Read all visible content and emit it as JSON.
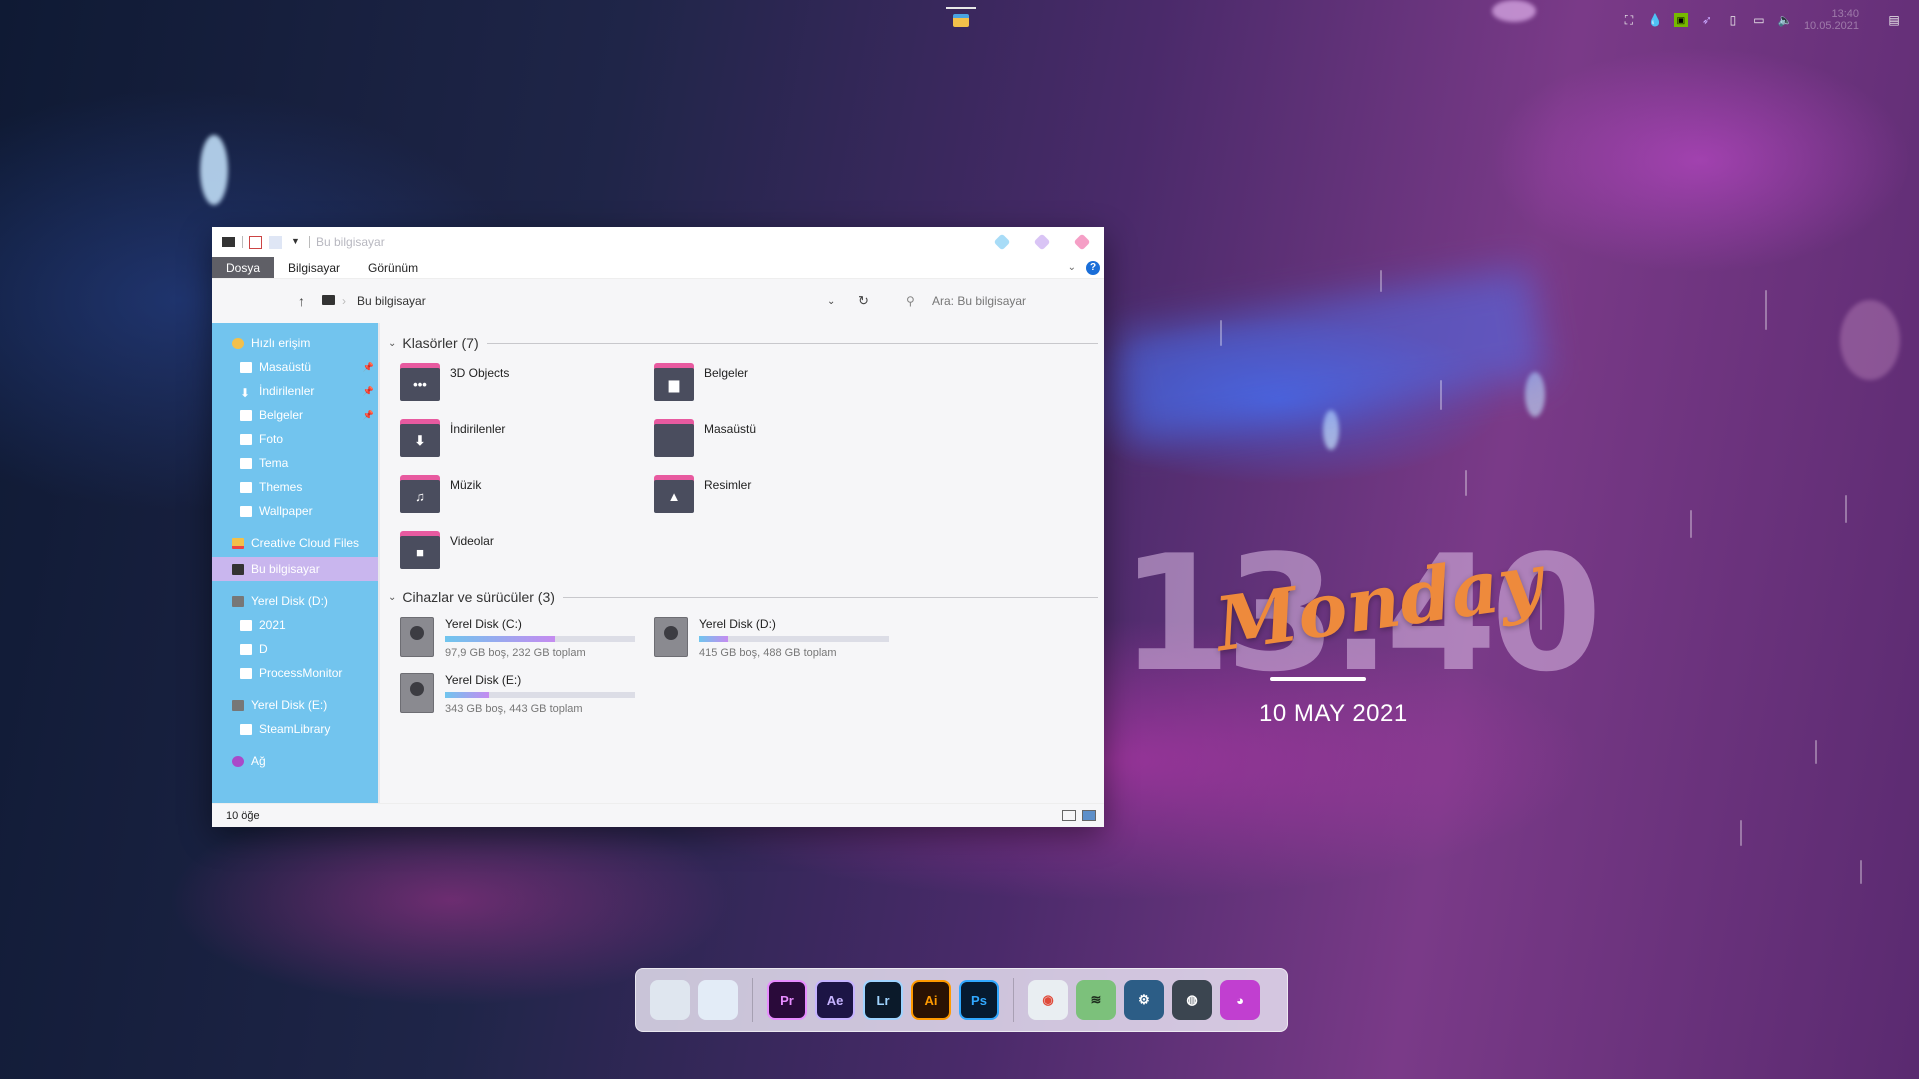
{
  "window": {
    "title": "Bu bilgisayar",
    "ribbon_tabs": [
      "Dosya",
      "Bilgisayar",
      "Görünüm"
    ],
    "help_label": "?",
    "address": {
      "path": "Bu bilgisayar",
      "search_placeholder": "Ara: Bu bilgisayar"
    },
    "nav": {
      "quick_access": "Hızlı erişim",
      "quick_items": [
        {
          "label": "Masaüstü",
          "pinned": true
        },
        {
          "label": "İndirilenler",
          "pinned": true
        },
        {
          "label": "Belgeler",
          "pinned": true
        },
        {
          "label": "Foto",
          "pinned": false
        },
        {
          "label": "Tema",
          "pinned": false
        },
        {
          "label": "Themes",
          "pinned": false
        },
        {
          "label": "Wallpaper",
          "pinned": false
        }
      ],
      "creative_cloud": "Creative Cloud Files",
      "this_pc": "Bu bilgisayar",
      "disk_d": "Yerel Disk (D:)",
      "disk_d_items": [
        "2021",
        "D",
        "ProcessMonitor"
      ],
      "disk_e": "Yerel Disk (E:)",
      "disk_e_items": [
        "SteamLibrary"
      ],
      "network": "Ağ"
    },
    "folders_header": "Klasörler (7)",
    "folders": [
      {
        "name": "3D Objects",
        "icon": "dots-icon",
        "glyph": "•••"
      },
      {
        "name": "Belgeler",
        "icon": "document-icon",
        "glyph": "▆"
      },
      {
        "name": "İndirilenler",
        "icon": "download-icon",
        "glyph": "⬇"
      },
      {
        "name": "Masaüstü",
        "icon": "desktop-icon",
        "glyph": ""
      },
      {
        "name": "Müzik",
        "icon": "music-icon",
        "glyph": "♫"
      },
      {
        "name": "Resimler",
        "icon": "picture-icon",
        "glyph": "▲"
      },
      {
        "name": "Videolar",
        "icon": "video-icon",
        "glyph": "■"
      }
    ],
    "devices_header": "Cihazlar ve sürücüler (3)",
    "drives": [
      {
        "name": "Yerel Disk (C:)",
        "info": "97,9 GB boş, 232 GB toplam",
        "used_fraction": 0.58
      },
      {
        "name": "Yerel Disk (D:)",
        "info": "415 GB boş, 488 GB toplam",
        "used_fraction": 0.15
      },
      {
        "name": "Yerel Disk (E:)",
        "info": "343 GB boş, 443 GB toplam",
        "used_fraction": 0.23
      }
    ],
    "status": "10 öğe"
  },
  "desktop_widget": {
    "time": "13.40",
    "day": "Monday",
    "date": "10 MAY 2021"
  },
  "tray": {
    "time": "13:40",
    "date": "10.05.2021"
  },
  "dock": {
    "items": [
      {
        "icon": "computer-icon",
        "label": "",
        "bg": "#dfe6ef",
        "fg": "#4a6a90"
      },
      {
        "icon": "document-icon",
        "label": "",
        "bg": "#e3ecf7",
        "fg": "#3f7ad6"
      },
      {
        "sep": true
      },
      {
        "icon": "premiere-icon",
        "label": "Pr",
        "bg": "#2a0a3a",
        "fg": "#e88cff"
      },
      {
        "icon": "after-effects-icon",
        "label": "Ae",
        "bg": "#1c1545",
        "fg": "#c6b4ff"
      },
      {
        "icon": "lightroom-icon",
        "label": "Lr",
        "bg": "#0b1a2a",
        "fg": "#9fd4ff"
      },
      {
        "icon": "illustrator-icon",
        "label": "Ai",
        "bg": "#2a1203",
        "fg": "#ff9a00"
      },
      {
        "icon": "photoshop-icon",
        "label": "Ps",
        "bg": "#061a30",
        "fg": "#31a8ff"
      },
      {
        "sep": true
      },
      {
        "icon": "chrome-icon",
        "label": "◉",
        "bg": "#e9eef2",
        "fg": "#e04a3a"
      },
      {
        "icon": "spotify-icon",
        "label": "≋",
        "bg": "#7cc17b",
        "fg": "#1c2b1c"
      },
      {
        "icon": "steam-icon",
        "label": "⚙",
        "bg": "#2c5d86",
        "fg": "#ffffff"
      },
      {
        "icon": "sync-icon",
        "label": "◍",
        "bg": "#3b4550",
        "fg": "#ffffff"
      },
      {
        "icon": "discord-icon",
        "label": "◕",
        "bg": "#c13fd0",
        "fg": "#ffffff"
      }
    ]
  }
}
